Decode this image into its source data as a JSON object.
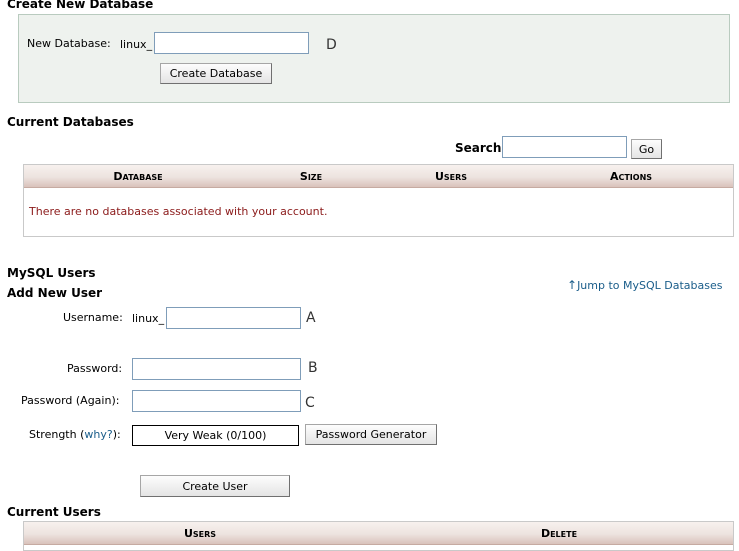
{
  "create_db": {
    "heading": "Create New Database",
    "label": "New Database:",
    "prefix": "linux_",
    "value": "",
    "marker": "D",
    "button": "Create Database"
  },
  "current_dbs": {
    "heading": "Current Databases",
    "search_label": "Search",
    "search_value": "",
    "go_button": "Go",
    "columns": [
      "Database",
      "Size",
      "Users",
      "Actions"
    ],
    "empty_message": "There are no databases associated with your account."
  },
  "mysql_users": {
    "heading": "MySQL Users",
    "subheading": "Add New User",
    "jump_link": "Jump to MySQL Databases",
    "username_label": "Username:",
    "username_prefix": "linux_",
    "username_value": "",
    "marker_a": "A",
    "password_label": "Password:",
    "password_value": "",
    "marker_b": "B",
    "password_again_label": "Password (Again):",
    "password_again_value": "",
    "marker_c": "C",
    "strength_label": "Strength",
    "strength_open": "(",
    "strength_link": "why?",
    "strength_close": "):",
    "strength_value": "Very Weak (0/100)",
    "generator_button": "Password Generator",
    "create_user_button": "Create User"
  },
  "current_users": {
    "heading": "Current Users",
    "columns": [
      "Users",
      "Delete"
    ]
  },
  "colors": {
    "error_text": "#8b1a1a",
    "link": "#1a5d8a",
    "panel_bg": "#eef2ee",
    "header_band": "#d9c2bb"
  }
}
